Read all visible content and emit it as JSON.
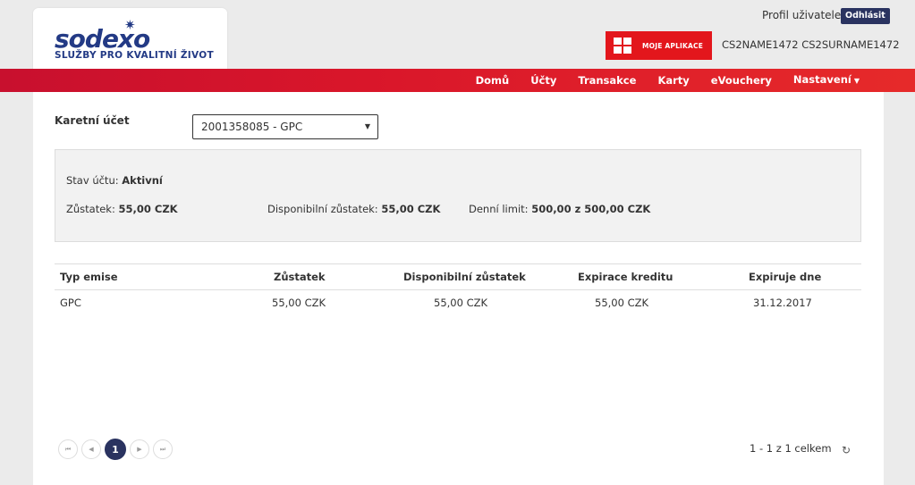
{
  "brand": {
    "logo_text": "sodexo",
    "tagline": "SLUŽBY PRO KVALITNÍ ŽIVOT"
  },
  "header": {
    "profile_link": "Profil uživatele",
    "logout": "Odhlásit",
    "apps_button": "MOJE APLIKACE",
    "user_name": "CS2NAME1472 CS2SURNAME1472"
  },
  "nav": {
    "items": [
      {
        "label": "Domů"
      },
      {
        "label": "Účty"
      },
      {
        "label": "Transakce"
      },
      {
        "label": "Karty"
      },
      {
        "label": "eVouchery"
      },
      {
        "label": "Nastavení"
      }
    ]
  },
  "account": {
    "label": "Karetní účet",
    "selected": "2001358085 - GPC"
  },
  "info": {
    "status_label": "Stav účtu:",
    "status_value": "Aktivní",
    "balance_label": "Zůstatek:",
    "balance_value": "55,00 CZK",
    "available_label": "Disponibilní zůstatek:",
    "available_value": "55,00 CZK",
    "limit_label": "Denní limit:",
    "limit_value": "500,00 z 500,00 CZK"
  },
  "table": {
    "headers": [
      "Typ emise",
      "Zůstatek",
      "Disponibilní zůstatek",
      "Expirace kreditu",
      "Expiruje dne"
    ],
    "rows": [
      [
        "GPC",
        "55,00 CZK",
        "55,00 CZK",
        "55,00 CZK",
        "31.12.2017"
      ]
    ]
  },
  "pager": {
    "current_page": "1",
    "info": "1 - 1 z 1 celkem"
  },
  "colors": {
    "brand_blue": "#233a85",
    "nav_red": "#d9162a",
    "dark_button": "#2a3360"
  }
}
